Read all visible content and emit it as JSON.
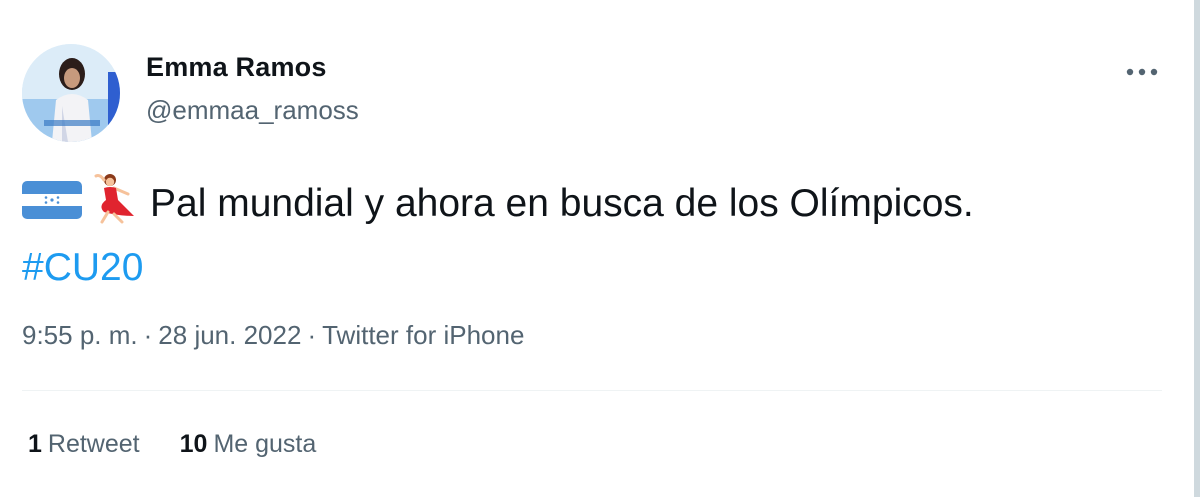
{
  "tweet": {
    "author": {
      "display_name": "Emma Ramos",
      "handle": "@emmaa_ramoss"
    },
    "more_icon": "more-horizontal-icon",
    "text": "Pal mundial y ahora en busca de los Olímpicos.",
    "emojis": [
      "honduras-flag",
      "dancer"
    ],
    "hashtag": "#CU20",
    "time": "9:55 p. m.",
    "separator": "·",
    "date": "28 jun. 2022",
    "source": "Twitter for iPhone",
    "stats": {
      "retweets_count": "1",
      "retweets_label": "Retweet",
      "likes_count": "10",
      "likes_label": "Me gusta"
    },
    "colors": {
      "link": "#1d9bf0",
      "secondary_text": "#536471",
      "primary_text": "#0f1419",
      "flag_blue": "#4a8fd6"
    }
  }
}
